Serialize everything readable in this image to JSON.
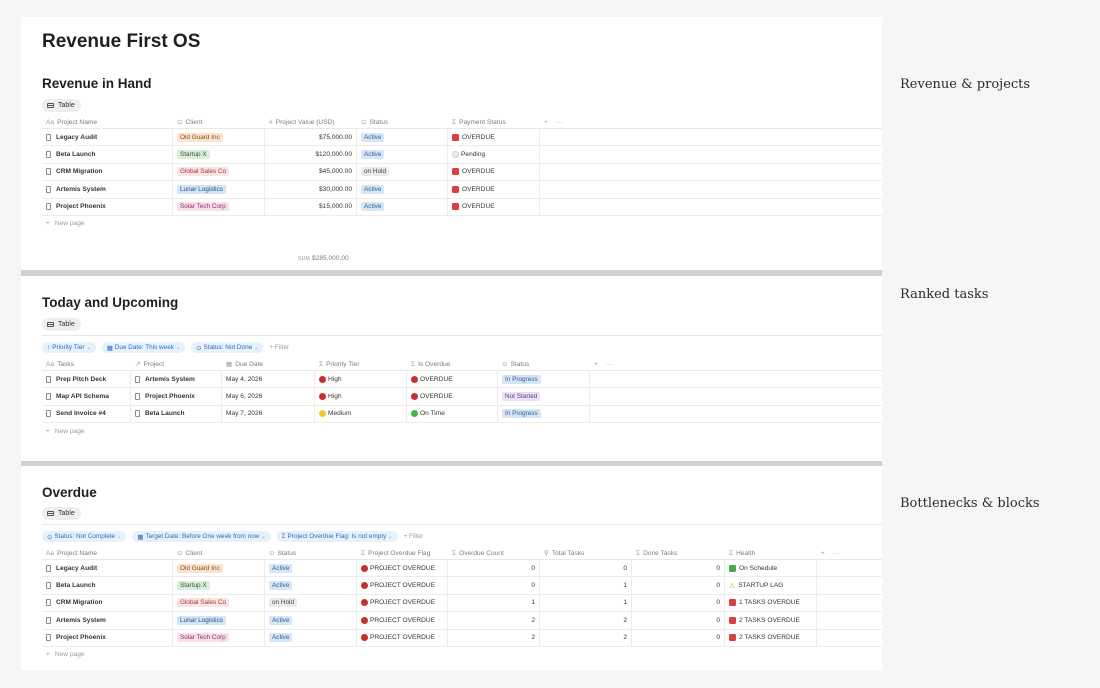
{
  "page_title": "Revenue First OS",
  "side_labels": [
    "Revenue & projects",
    "Ranked tasks",
    "Bottlenecks & blocks"
  ],
  "revenue": {
    "title": "Revenue in Hand",
    "view": "Table",
    "columns": [
      "Project Name",
      "Client",
      "Project Value (USD)",
      "Status",
      "Payment Status"
    ],
    "rows": [
      {
        "name": "Legacy Audit",
        "client": "Old Guard Inc",
        "client_color": "orange",
        "value": "$75,000.00",
        "status": "Active",
        "payment": "OVERDUE",
        "payment_icon": "red-square"
      },
      {
        "name": "Beta Launch",
        "client": "Startup X",
        "client_color": "green",
        "value": "$120,000.00",
        "status": "Active",
        "payment": "Pending",
        "payment_icon": "white-circle"
      },
      {
        "name": "CRM Migration",
        "client": "Global Sales Co",
        "client_color": "red",
        "value": "$45,000.00",
        "status": "on Hold",
        "payment": "OVERDUE",
        "payment_icon": "red-square"
      },
      {
        "name": "Artemis System",
        "client": "Lunar Logistics",
        "client_color": "blue",
        "value": "$30,000.00",
        "status": "Active",
        "payment": "OVERDUE",
        "payment_icon": "red-square"
      },
      {
        "name": "Project Phoenix",
        "client": "Solar Tech Corp",
        "client_color": "pink",
        "value": "$15,000.00",
        "status": "Active",
        "payment": "OVERDUE",
        "payment_icon": "red-square"
      }
    ],
    "new_page": "New page",
    "sum_label": "SUM",
    "sum_value": "$285,000.00"
  },
  "today": {
    "title": "Today and Upcoming",
    "view": "Table",
    "filters": [
      "Priority Tier",
      "Due Date: This week",
      "Status: Not Done"
    ],
    "filter_button": "Filter",
    "columns": [
      "Tasks",
      "Project",
      "Due Date",
      "Priority Tier",
      "Is Overdue",
      "Status"
    ],
    "rows": [
      {
        "task": "Prep Pitch Deck",
        "project": "Artemis System",
        "due": "May 4, 2026",
        "priority": "High",
        "priority_dot": "red",
        "overdue": "OVERDUE",
        "overdue_dot": "red",
        "status": "In Progress",
        "status_color": "blue"
      },
      {
        "task": "Map API Schema",
        "project": "Project Phoenix",
        "due": "May 6, 2026",
        "priority": "High",
        "priority_dot": "red",
        "overdue": "OVERDUE",
        "overdue_dot": "red",
        "status": "Not Started",
        "status_color": "purple"
      },
      {
        "task": "Send Invoice #4",
        "project": "Beta Launch",
        "due": "May 7, 2026",
        "priority": "Medium",
        "priority_dot": "yellow",
        "overdue": "On Time",
        "overdue_dot": "green",
        "status": "In Progress",
        "status_color": "blue"
      }
    ],
    "new_page": "New page"
  },
  "overdue": {
    "title": "Overdue",
    "view": "Table",
    "filters": [
      "Status: Not Complete",
      "Target Date: Before One week from now",
      "Project Overdue Flag: Is not empty"
    ],
    "filter_button": "Filter",
    "columns": [
      "Project Name",
      "Client",
      "Status",
      "Project Overdue Flag",
      "Overdue Count",
      "Total Tasks",
      "Done Tasks",
      "Health"
    ],
    "rows": [
      {
        "name": "Legacy Audit",
        "client": "Old Guard Inc",
        "client_color": "orange",
        "status": "Active",
        "flag": "PROJECT OVERDUE",
        "overdue_count": "0",
        "total": "0",
        "done": "0",
        "health": "On Schedule",
        "health_icon": "green-check"
      },
      {
        "name": "Beta Launch",
        "client": "Startup X",
        "client_color": "green",
        "status": "Active",
        "flag": "PROJECT OVERDUE",
        "overdue_count": "0",
        "total": "1",
        "done": "0",
        "health": "STARTUP LAG",
        "health_icon": "warning"
      },
      {
        "name": "CRM Migration",
        "client": "Global Sales Co",
        "client_color": "red",
        "status": "on Hold",
        "flag": "PROJECT OVERDUE",
        "overdue_count": "1",
        "total": "1",
        "done": "0",
        "health": "1 TASKS OVERDUE",
        "health_icon": "red-square"
      },
      {
        "name": "Artemis System",
        "client": "Lunar Logistics",
        "client_color": "blue",
        "status": "Active",
        "flag": "PROJECT OVERDUE",
        "overdue_count": "2",
        "total": "2",
        "done": "0",
        "health": "2 TASKS OVERDUE",
        "health_icon": "red-square"
      },
      {
        "name": "Project Phoenix",
        "client": "Solar Tech Corp",
        "client_color": "pink",
        "status": "Active",
        "flag": "PROJECT OVERDUE",
        "overdue_count": "2",
        "total": "2",
        "done": "0",
        "health": "2 TASKS OVERDUE",
        "health_icon": "red-square"
      }
    ],
    "new_page": "New page"
  }
}
